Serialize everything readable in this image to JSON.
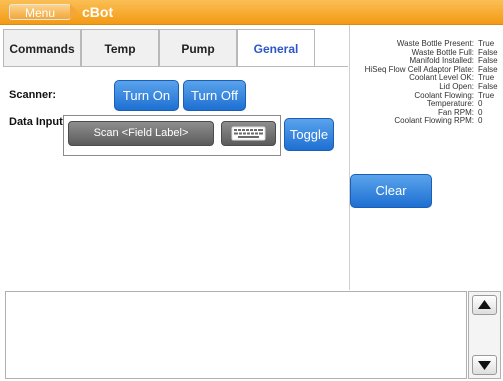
{
  "title_bar": {
    "menu_label": "Menu",
    "app_title": "cBot",
    "accent": "#f39a14"
  },
  "tabs": [
    {
      "label": "Commands",
      "active": false
    },
    {
      "label": "Temp",
      "active": false
    },
    {
      "label": "Pump",
      "active": false
    },
    {
      "label": "General",
      "active": true
    }
  ],
  "general": {
    "scanner_label": "Scanner:",
    "turn_on_label": "Turn On",
    "turn_off_label": "Turn Off",
    "data_input_label": "Data Input:",
    "scan_label": "Scan <Field Label>",
    "toggle_label": "Toggle",
    "clear_label": "Clear"
  },
  "status": [
    {
      "key": "Waste Bottle Present:",
      "value": "True"
    },
    {
      "key": "Waste Bottle Full:",
      "value": "False"
    },
    {
      "key": "Manifold Installed:",
      "value": "False"
    },
    {
      "key": "HiSeq Flow Cell Adaptor Plate:",
      "value": "False"
    },
    {
      "key": "Coolant Level OK:",
      "value": "True"
    },
    {
      "key": "Lid Open:",
      "value": "False"
    },
    {
      "key": "Coolant Flowing:",
      "value": "True"
    },
    {
      "key": "Temperature:",
      "value": "0"
    },
    {
      "key": "Fan RPM:",
      "value": "0"
    },
    {
      "key": "Coolant Flowing RPM:",
      "value": "0"
    }
  ],
  "icons": {
    "keyboard": "keyboard-icon",
    "scroll_up": "arrow-up-icon",
    "scroll_down": "arrow-down-icon"
  }
}
